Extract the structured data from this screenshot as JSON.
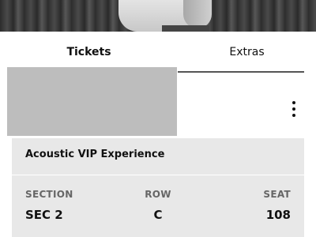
{
  "tabs": [
    {
      "label": "Tickets",
      "active": true
    },
    {
      "label": "Extras",
      "active": false
    }
  ],
  "menu": {
    "icon": "more-vertical-icon"
  },
  "ticket": {
    "event_title": "Acoustic VIP Experience",
    "section_label": "SECTION",
    "section_value": "SEC 2",
    "row_label": "ROW",
    "row_value": "C",
    "seat_label": "SEAT",
    "seat_value": "108"
  },
  "colors": {
    "card_background": "#e8e8e8",
    "placeholder": "#bdbdbd",
    "tab_underline": "#555555"
  }
}
